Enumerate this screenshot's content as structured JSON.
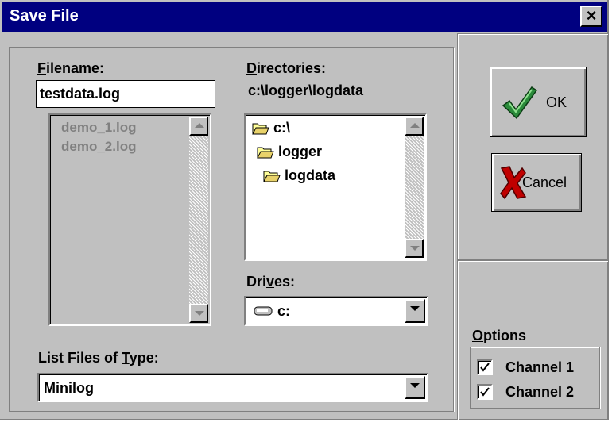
{
  "window": {
    "title": "Save File",
    "close_glyph": "×"
  },
  "filename": {
    "label_accel": "F",
    "label_rest": "ilename:",
    "value": "testdata.log",
    "files": [
      "demo_1.log",
      "demo_2.log"
    ]
  },
  "directories": {
    "label_accel": "D",
    "label_rest": "irectories:",
    "current_path": "c:\\logger\\logdata",
    "items": [
      "c:\\",
      "logger",
      "logdata"
    ]
  },
  "drives": {
    "label_pre": "Dri",
    "label_accel": "v",
    "label_post": "es:",
    "selected": "c:"
  },
  "file_type": {
    "label_pre": "List Files of ",
    "label_accel": "T",
    "label_post": "ype:",
    "selected": "Minilog"
  },
  "buttons": {
    "ok_label": "OK",
    "cancel_label": "Cancel"
  },
  "options": {
    "label_accel": "O",
    "label_rest": "ptions",
    "channels": [
      {
        "label": "Channel 1",
        "checked": true
      },
      {
        "label": "Channel 2",
        "checked": true
      }
    ]
  },
  "colors": {
    "titlebar": "#000080",
    "face": "#c0c0c0",
    "ok_check": "#2a8a3a",
    "cancel_x": "#c00000"
  }
}
